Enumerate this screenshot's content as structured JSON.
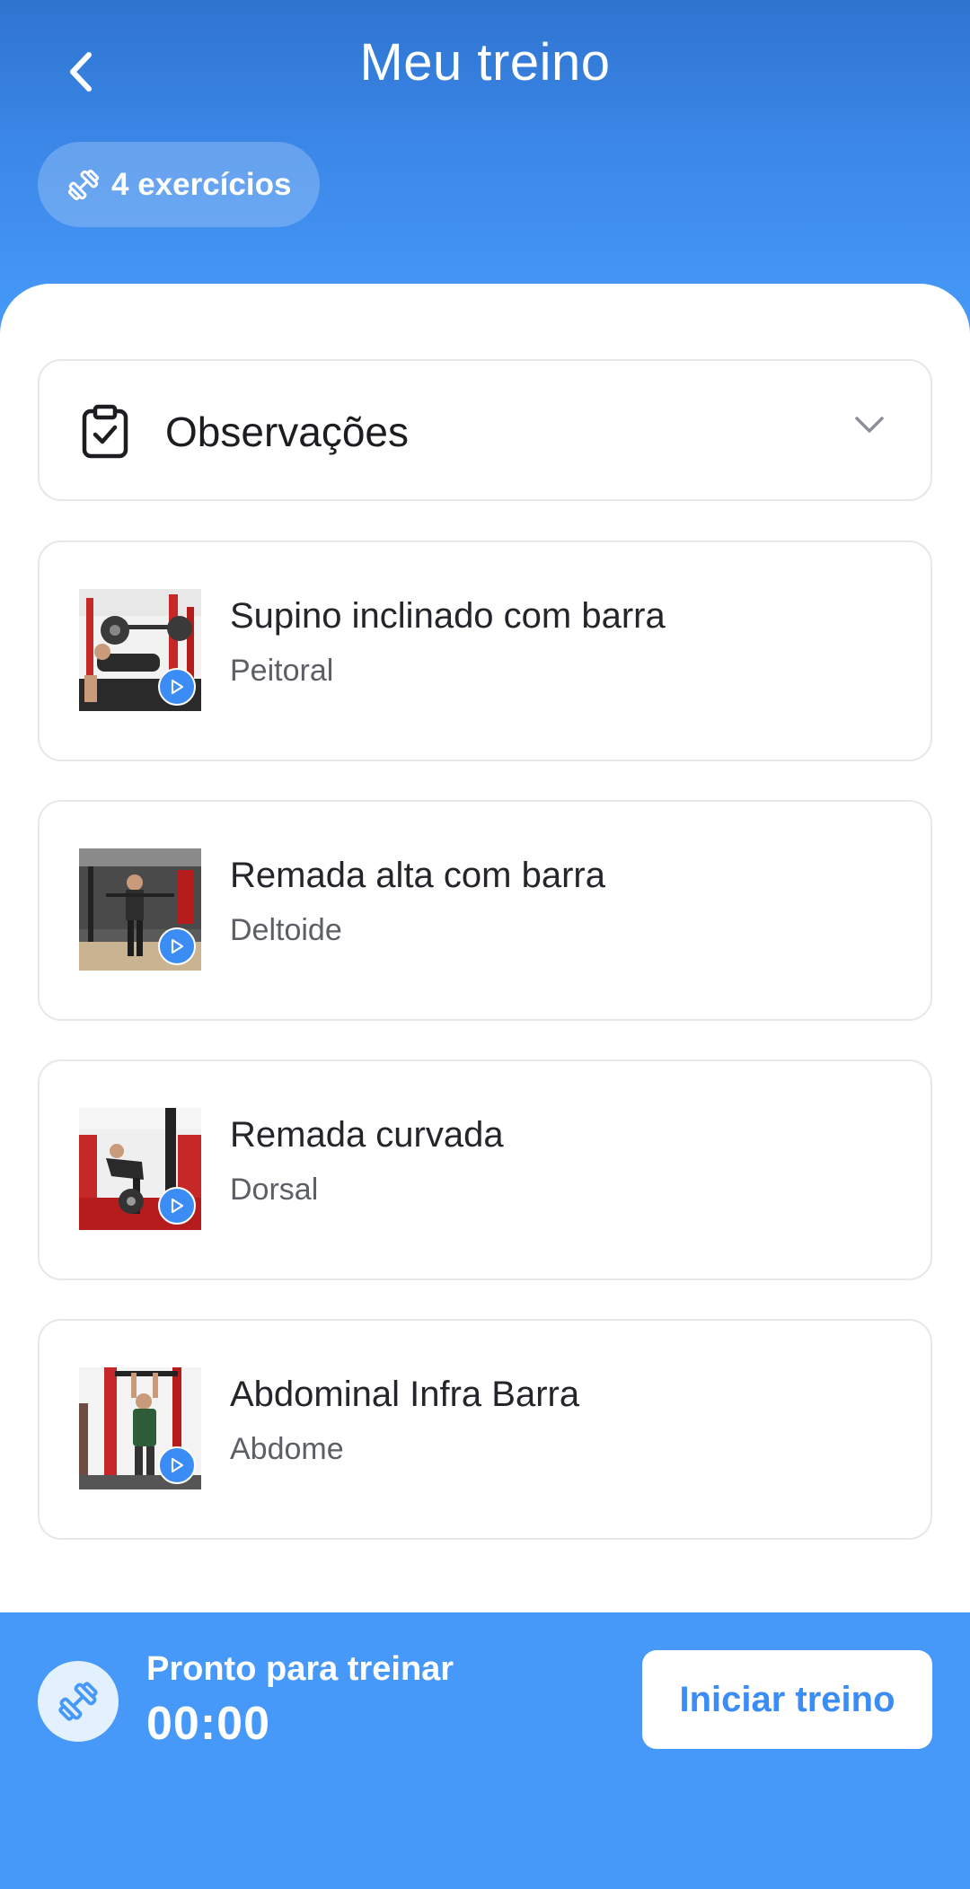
{
  "header": {
    "title": "Meu treino",
    "back_icon": "chevron-left-icon",
    "badge_icon": "dumbbell-icon",
    "badge_label": "4 exercícios"
  },
  "observations": {
    "icon": "clipboard-check-icon",
    "label": "Observações",
    "toggle_icon": "chevron-down-icon"
  },
  "exercises": [
    {
      "name": "Supino inclinado com barra",
      "muscle": "Peitoral",
      "thumbnail_icon": "play-icon"
    },
    {
      "name": "Remada alta com barra",
      "muscle": "Deltoide",
      "thumbnail_icon": "play-icon"
    },
    {
      "name": "Remada curvada",
      "muscle": "Dorsal",
      "thumbnail_icon": "play-icon"
    },
    {
      "name": "Abdominal Infra Barra",
      "muscle": "Abdome",
      "thumbnail_icon": "play-icon"
    }
  ],
  "footer": {
    "icon": "dumbbell-icon",
    "status": "Pronto para treinar",
    "timer": "00:00",
    "start_label": "Iniciar treino"
  },
  "colors": {
    "accent": "#4699F8",
    "header_top": "#2F74CF",
    "play_button": "#3B8CF5"
  }
}
